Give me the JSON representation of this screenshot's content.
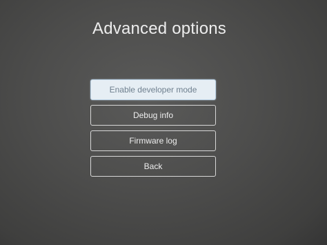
{
  "screen": {
    "title": "Advanced options"
  },
  "menu": {
    "selected_index": 0,
    "items": [
      {
        "label": "Enable developer mode"
      },
      {
        "label": "Debug info"
      },
      {
        "label": "Firmware log"
      },
      {
        "label": "Back"
      }
    ]
  },
  "colors": {
    "background": "#4b4b4a",
    "text": "#ececec",
    "button_border": "#d8d8d8",
    "selected_fill": "#e6eef4",
    "selected_text": "#6e7f8e"
  }
}
